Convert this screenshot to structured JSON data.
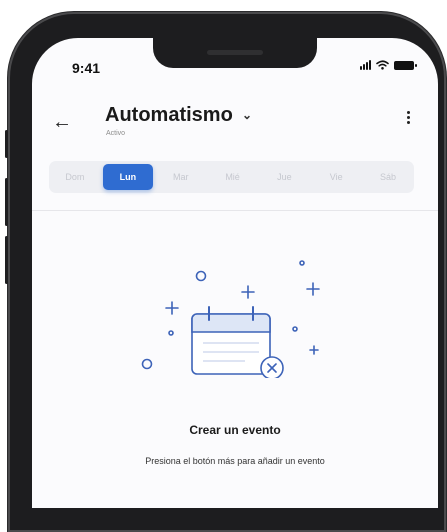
{
  "status_bar": {
    "time": "9:41"
  },
  "header": {
    "back_icon": "←",
    "title": "Automatismo",
    "dropdown_icon": "⌄",
    "subtitle": "Activo",
    "menu_icon": "kebab-vertical"
  },
  "days": [
    {
      "label": "Dom",
      "active": false
    },
    {
      "label": "Lun",
      "active": true
    },
    {
      "label": "Mar",
      "active": false
    },
    {
      "label": "Mié",
      "active": false
    },
    {
      "label": "Jue",
      "active": false
    },
    {
      "label": "Vie",
      "active": false
    },
    {
      "label": "Sáb",
      "active": false
    }
  ],
  "empty_state": {
    "title": "Crear un evento",
    "description": "Presiona el botón más para añadir un evento",
    "icon": "calendar-x-icon"
  },
  "colors": {
    "accent": "#2f6cd1",
    "illustration": "#3d63b8",
    "illustration_fill": "#dde6f6"
  }
}
